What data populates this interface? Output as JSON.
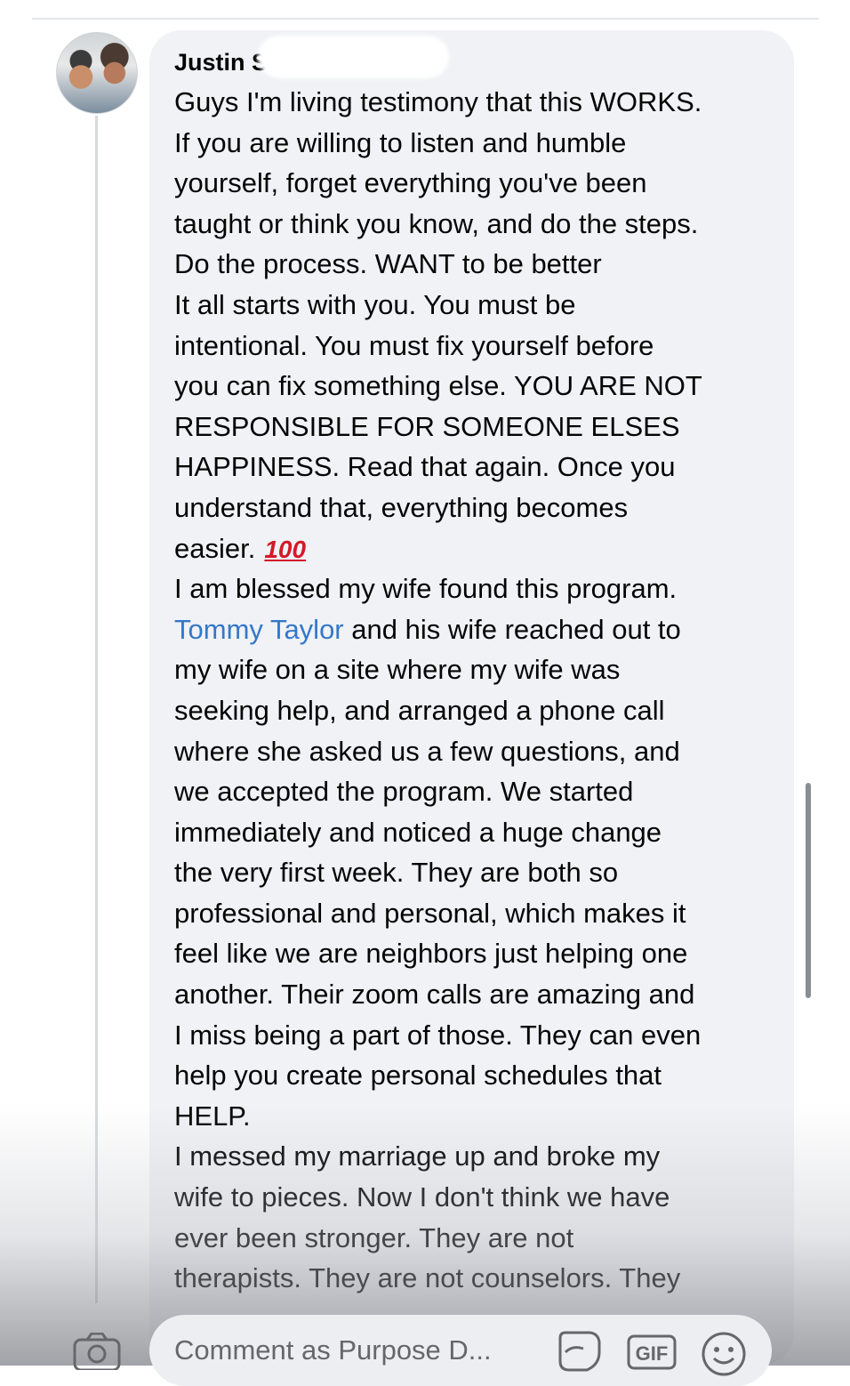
{
  "comment": {
    "author": "Justin S",
    "lines": [
      "Guys I'm living testimony that this WORKS.",
      "If you are willing to listen and humble",
      "yourself, forget everything you've been",
      "taught or think you know, and do the steps.",
      "Do the process. WANT to be better",
      "It all starts with you. You must be",
      "intentional.  You must fix yourself before",
      "you can fix something else. YOU ARE NOT",
      "RESPONSIBLE FOR SOMEONE ELSES",
      "HAPPINESS. Read that again. Once you",
      "understand that, everything becomes",
      "easier.",
      "I am blessed my wife found this program.",
      " and his wife reached out to",
      "my wife on a site where my wife was",
      "seeking help, and arranged a phone call",
      "where she asked us a few questions, and",
      "we accepted the program. We started",
      "immediately and noticed a huge change",
      "the very first week. They are both so",
      "professional and personal, which makes it",
      "feel like we are neighbors just helping one",
      "another. Their zoom calls are amazing and",
      "I miss being a part of those. They can even",
      "help you create personal schedules that",
      "HELP.",
      "I messed my marriage up and broke my",
      "wife to pieces. Now I don't think we have",
      "ever been stronger. They are not",
      "therapists. They are not counselors. They"
    ],
    "emoji_100": "100",
    "mention": "Tommy Taylor"
  },
  "composer": {
    "placeholder": "Comment as Purpose D...",
    "gif_label": "GIF"
  },
  "colors": {
    "bubble": "#f0f2f5",
    "link": "#3578c9",
    "text": "#050505"
  }
}
